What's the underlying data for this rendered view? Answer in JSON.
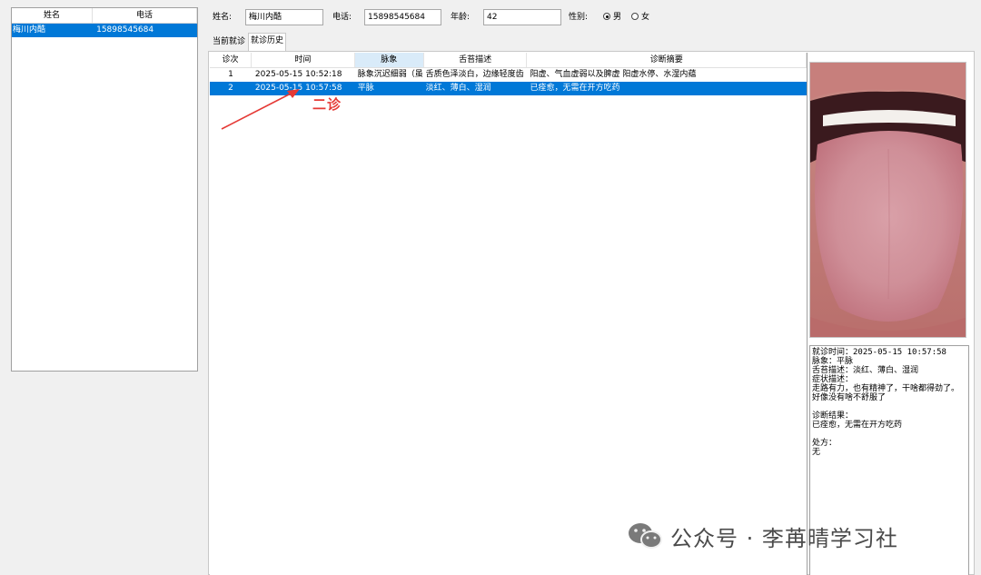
{
  "patient_list": {
    "headers": [
      "姓名",
      "电话"
    ],
    "rows": [
      {
        "name": "梅川内酷",
        "phone": "15898545684",
        "selected": true
      }
    ]
  },
  "form": {
    "name_label": "姓名:",
    "name_value": "梅川内酷",
    "phone_label": "电话:",
    "phone_value": "15898545684",
    "age_label": "年龄:",
    "age_value": "42",
    "gender_label": "性别:",
    "gender_male": "男",
    "gender_female": "女",
    "gender_selected": "男"
  },
  "tabs": [
    {
      "label": "当前就诊",
      "active": false
    },
    {
      "label": "就诊历史",
      "active": true
    }
  ],
  "history": {
    "headers": [
      "诊次",
      "时间",
      "脉象",
      "舌苔描述",
      "诊断摘要"
    ],
    "rows": [
      {
        "no": "1",
        "time": "2025-05-15 10:52:18",
        "pulse": "脉象沉迟细弱（虽",
        "tongue": "舌质色泽淡白，边缘轻度齿",
        "summary": "阳虚、气血虚弱以及脾虚  阳虚水停、水湿内蕴",
        "selected": false
      },
      {
        "no": "2",
        "time": "2025-05-15 10:57:58",
        "pulse": "平脉",
        "tongue": "淡红、薄白、湿润",
        "summary": "已痊愈，无需在开方吃药",
        "selected": true
      }
    ]
  },
  "detail": {
    "text": "就诊时间：2025-05-15 10:57:58\n脉象：平脉\n舌苔描述：淡红、薄白、湿润\n症状描述：\n走路有力，也有精神了，干啥都得劲了。好像没有啥不舒服了\n\n诊断结果：\n已痊愈，无需在开方吃药\n\n处方：\n无"
  },
  "annotation": {
    "label": "二诊",
    "color": "#e53935"
  },
  "watermark": {
    "icon": "wechat-icon",
    "text": "公众号 · 李苒晴学习社"
  },
  "colors": {
    "selection": "#0078d7",
    "annotation": "#e53935"
  }
}
